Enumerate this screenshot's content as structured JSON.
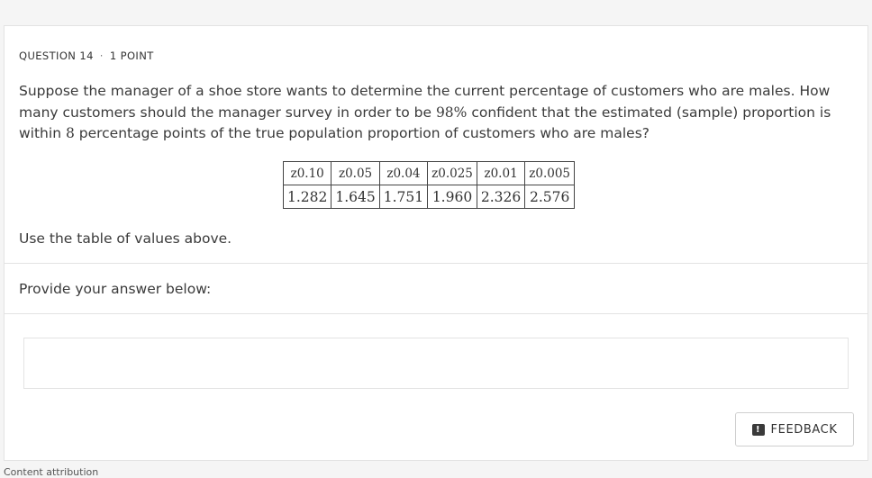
{
  "question": {
    "number_label": "QUESTION 14",
    "separator": "·",
    "points_label": "1 POINT",
    "text_part1": "Suppose the manager of a shoe store wants to determine the current percentage of customers who are males. How many customers should the manager survey in order to be ",
    "text_percent": "98%",
    "text_part2": " confident that the estimated (sample) proportion is within ",
    "text_points": "8",
    "text_part3": " percentage points of the true population proportion of customers who are males?"
  },
  "z_table": {
    "headers": [
      "z0.10",
      "z0.05",
      "z0.04",
      "z0.025",
      "z0.01",
      "z0.005"
    ],
    "values": [
      "1.282",
      "1.645",
      "1.751",
      "1.960",
      "2.326",
      "2.576"
    ]
  },
  "use_table_text": "Use the table of values above.",
  "answer_prompt": "Provide your answer below:",
  "answer_value": "",
  "feedback": {
    "icon": "feedback-icon",
    "label": "FEEDBACK"
  },
  "footer": {
    "attribution": "Content attribution"
  }
}
